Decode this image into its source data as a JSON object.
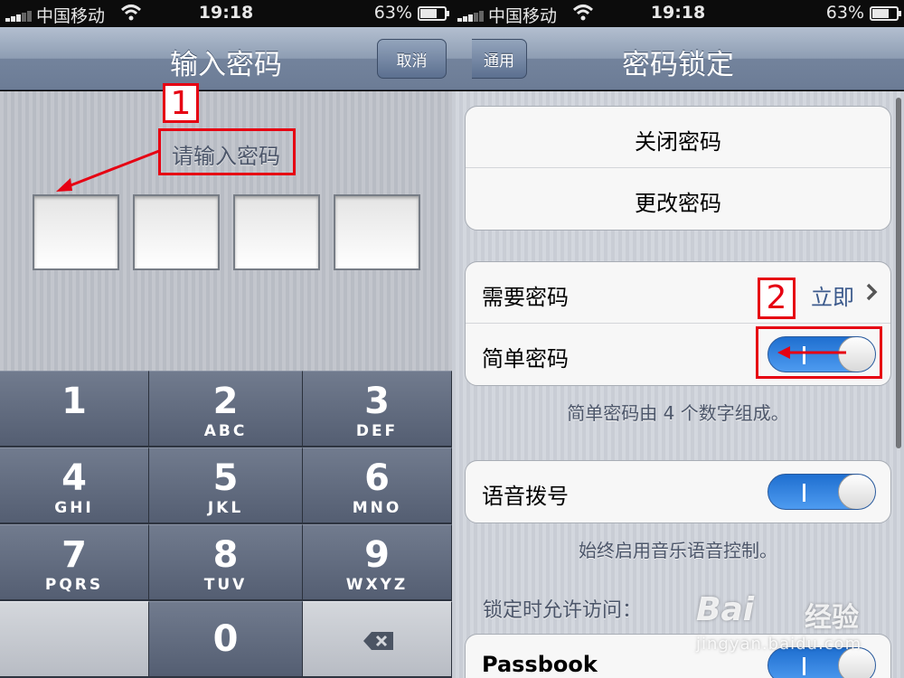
{
  "left_screen": {
    "status": {
      "carrier": "中国移动",
      "time": "19:18",
      "battery": "63%"
    },
    "nav": {
      "title": "输入密码",
      "cancel": "取消"
    },
    "prompt": "请输入密码",
    "keypad": [
      {
        "num": "1",
        "letters": ""
      },
      {
        "num": "2",
        "letters": "ABC"
      },
      {
        "num": "3",
        "letters": "DEF"
      },
      {
        "num": "4",
        "letters": "GHI"
      },
      {
        "num": "5",
        "letters": "JKL"
      },
      {
        "num": "6",
        "letters": "MNO"
      },
      {
        "num": "7",
        "letters": "PQRS"
      },
      {
        "num": "8",
        "letters": "TUV"
      },
      {
        "num": "9",
        "letters": "WXYZ"
      },
      {
        "num": "0",
        "letters": ""
      }
    ],
    "annotation": "1"
  },
  "right_screen": {
    "status": {
      "carrier": "中国移动",
      "time": "19:18",
      "battery": "63%"
    },
    "nav": {
      "title": "密码锁定",
      "back": "通用"
    },
    "group1": {
      "turn_off": "关闭密码",
      "change": "更改密码"
    },
    "group2": {
      "require_label": "需要密码",
      "require_value": "立即",
      "simple_label": "简单密码",
      "simple_on": true
    },
    "simple_note": "简单密码由 4 个数字组成。",
    "group3": {
      "voice_dial": "语音拨号",
      "voice_dial_on": true
    },
    "voice_note": "始终启用音乐语音控制。",
    "allow_access_label": "锁定时允许访问：",
    "group4": {
      "passbook": "Passbook",
      "passbook_on": true
    },
    "annotation": "2"
  },
  "watermark": {
    "brand": "Bai",
    "brand2": "经验",
    "url": "jingyan.baidu.com"
  },
  "colors": {
    "accent_red": "#e60012",
    "toggle_blue": "#2a7de1",
    "nav_blue": "#7a8aa3"
  }
}
